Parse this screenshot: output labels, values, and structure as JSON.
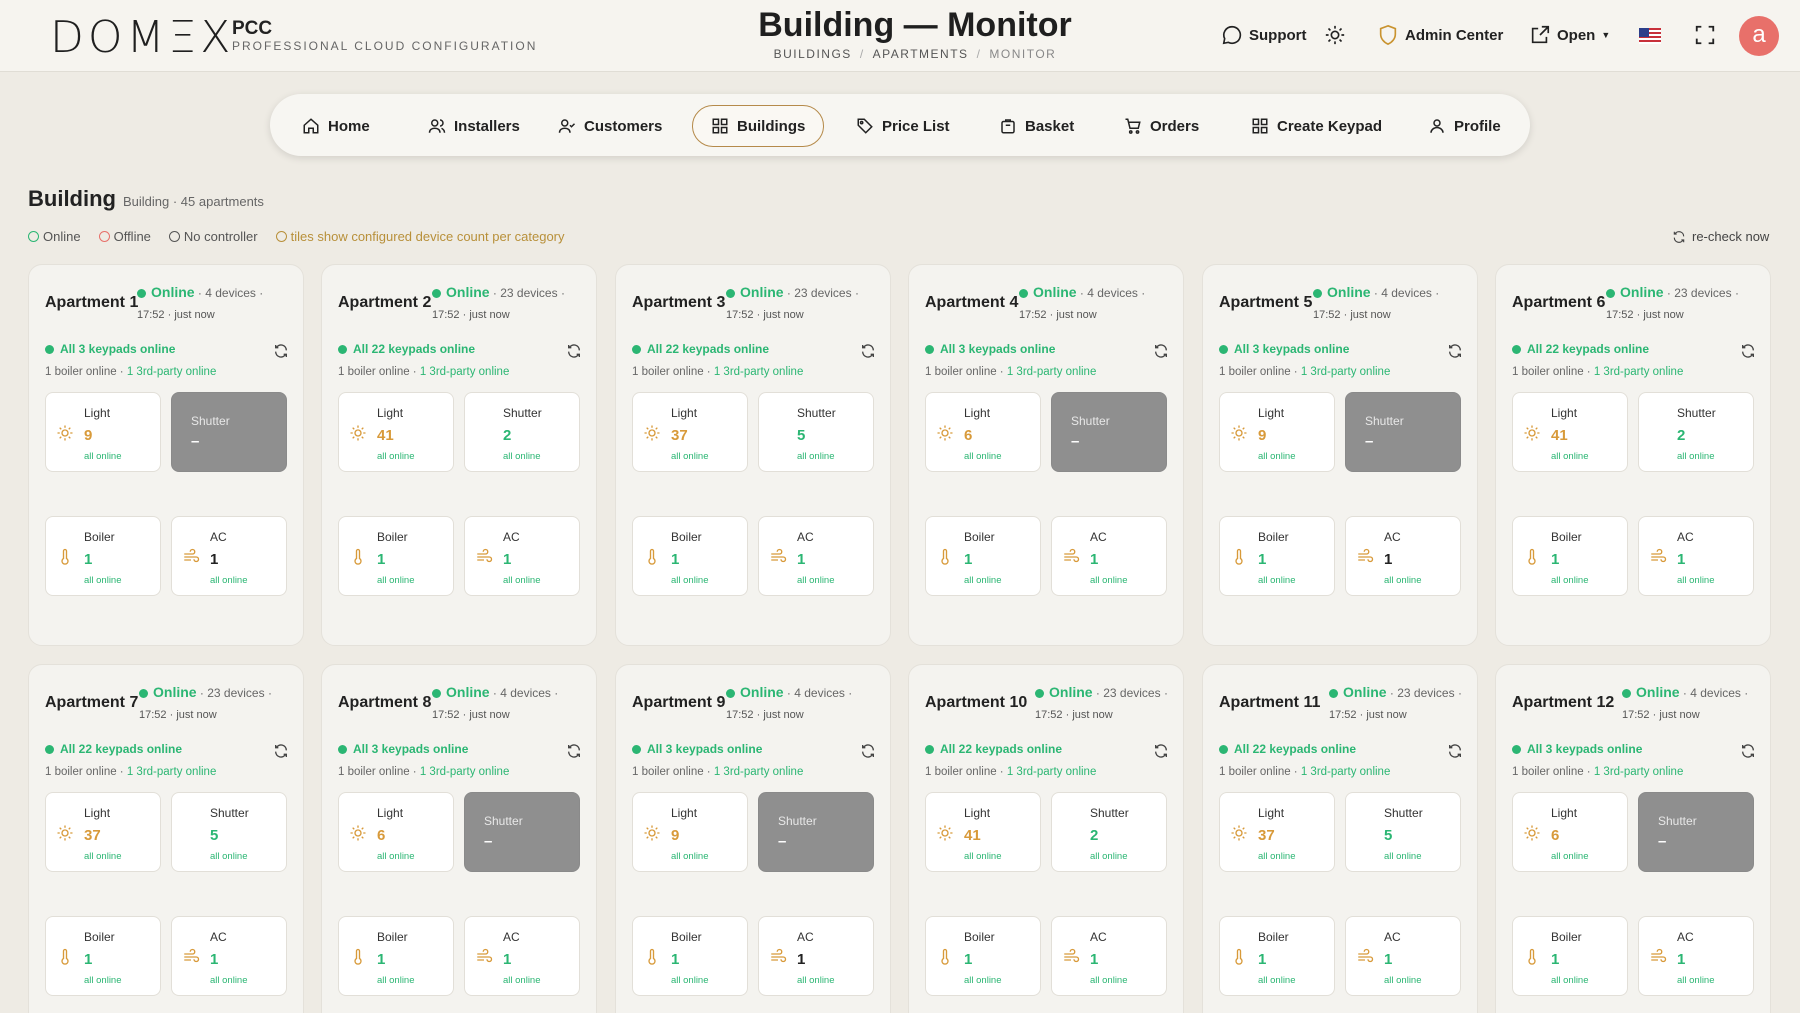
{
  "header": {
    "logo": "DOMΞX",
    "product": "PCC",
    "product_sub": "PROFESSIONAL CLOUD CONFIGURATION",
    "title": "Building — Monitor",
    "breadcrumb": [
      "BUILDINGS",
      "APARTMENTS",
      "MONITOR"
    ],
    "support": "Support",
    "admin_center": "Admin Center",
    "open": "Open",
    "avatar": "a"
  },
  "nav": [
    {
      "label": "Home",
      "icon": "home-icon"
    },
    {
      "label": "Installers",
      "icon": "users-icon"
    },
    {
      "label": "Customers",
      "icon": "user-check-icon"
    },
    {
      "label": "Buildings",
      "icon": "grid-icon",
      "active": true
    },
    {
      "label": "Price List",
      "icon": "tag-icon"
    },
    {
      "label": "Basket",
      "icon": "basket-icon"
    },
    {
      "label": "Orders",
      "icon": "cart-icon"
    },
    {
      "label": "Create Keypad",
      "icon": "keypad-icon"
    },
    {
      "label": "Profile",
      "icon": "person-icon"
    }
  ],
  "building": {
    "title": "Building",
    "subtitle": "Building · 45 apartments",
    "legend": {
      "online": "Online",
      "offline": "Offline",
      "no_controller": "No controller",
      "note": "tiles show configured device count per category"
    },
    "recheck": "re-check now"
  },
  "colors": {
    "online": "#2bb673",
    "light_value": "#d89a3a",
    "offline_tile": "#8f8f8f",
    "accent": "#b58a4a"
  },
  "apartments": [
    {
      "name": "Apartment 1",
      "status": "Online",
      "devices": "4 devices",
      "time": "17:52",
      "ago": "just now",
      "keypads": "All 3 keypads online",
      "boiler": "1 boiler online",
      "third": "1 3rd-party online",
      "light": "9",
      "shutter": "–",
      "shutter_off": true,
      "boiler_n": "1",
      "ac": "1"
    },
    {
      "name": "Apartment 2",
      "status": "Online",
      "devices": "23 devices",
      "time": "17:52",
      "ago": "just now",
      "keypads": "All 22 keypads online",
      "boiler": "1 boiler online",
      "third": "1 3rd-party online",
      "light": "41",
      "shutter": "2",
      "shutter_off": false,
      "boiler_n": "1",
      "ac": "1"
    },
    {
      "name": "Apartment 3",
      "status": "Online",
      "devices": "23 devices",
      "time": "17:52",
      "ago": "just now",
      "keypads": "All 22 keypads online",
      "boiler": "1 boiler online",
      "third": "1 3rd-party online",
      "light": "37",
      "shutter": "5",
      "shutter_off": false,
      "boiler_n": "1",
      "ac": "1"
    },
    {
      "name": "Apartment 4",
      "status": "Online",
      "devices": "4 devices",
      "time": "17:52",
      "ago": "just now",
      "keypads": "All 3 keypads online",
      "boiler": "1 boiler online",
      "third": "1 3rd-party online",
      "light": "6",
      "shutter": "–",
      "shutter_off": true,
      "boiler_n": "1",
      "ac": "1"
    },
    {
      "name": "Apartment 5",
      "status": "Online",
      "devices": "4 devices",
      "time": "17:52",
      "ago": "just now",
      "keypads": "All 3 keypads online",
      "boiler": "1 boiler online",
      "third": "1 3rd-party online",
      "light": "9",
      "shutter": "–",
      "shutter_off": true,
      "boiler_n": "1",
      "ac": "1"
    },
    {
      "name": "Apartment 6",
      "status": "Online",
      "devices": "23 devices",
      "time": "17:52",
      "ago": "just now",
      "keypads": "All 22 keypads online",
      "boiler": "1 boiler online",
      "third": "1 3rd-party online",
      "light": "41",
      "shutter": "2",
      "shutter_off": false,
      "boiler_n": "1",
      "ac": "1"
    },
    {
      "name": "Apartment 7",
      "status": "Online",
      "devices": "23 devices",
      "time": "17:52",
      "ago": "just now",
      "keypads": "All 22 keypads online",
      "boiler": "1 boiler online",
      "third": "1 3rd-party online",
      "light": "37",
      "shutter": "5",
      "shutter_off": false,
      "boiler_n": "1",
      "ac": "1"
    },
    {
      "name": "Apartment 8",
      "status": "Online",
      "devices": "4 devices",
      "time": "17:52",
      "ago": "just now",
      "keypads": "All 3 keypads online",
      "boiler": "1 boiler online",
      "third": "1 3rd-party online",
      "light": "6",
      "shutter": "–",
      "shutter_off": true,
      "boiler_n": "1",
      "ac": "1"
    },
    {
      "name": "Apartment 9",
      "status": "Online",
      "devices": "4 devices",
      "time": "17:52",
      "ago": "just now",
      "keypads": "All 3 keypads online",
      "boiler": "1 boiler online",
      "third": "1 3rd-party online",
      "light": "9",
      "shutter": "–",
      "shutter_off": true,
      "boiler_n": "1",
      "ac": "1"
    },
    {
      "name": "Apartment 10",
      "status": "Online",
      "devices": "23 devices",
      "time": "17:52",
      "ago": "just now",
      "keypads": "All 22 keypads online",
      "boiler": "1 boiler online",
      "third": "1 3rd-party online",
      "light": "41",
      "shutter": "2",
      "shutter_off": false,
      "boiler_n": "1",
      "ac": "1"
    },
    {
      "name": "Apartment 11",
      "status": "Online",
      "devices": "23 devices",
      "time": "17:52",
      "ago": "just now",
      "keypads": "All 22 keypads online",
      "boiler": "1 boiler online",
      "third": "1 3rd-party online",
      "light": "37",
      "shutter": "5",
      "shutter_off": false,
      "boiler_n": "1",
      "ac": "1"
    },
    {
      "name": "Apartment 12",
      "status": "Online",
      "devices": "4 devices",
      "time": "17:52",
      "ago": "just now",
      "keypads": "All 3 keypads online",
      "boiler": "1 boiler online",
      "third": "1 3rd-party online",
      "light": "6",
      "shutter": "–",
      "shutter_off": true,
      "boiler_n": "1",
      "ac": "1"
    }
  ],
  "tile_labels": {
    "light": "Light",
    "shutter": "Shutter",
    "boiler": "Boiler",
    "ac": "AC",
    "sub": "all online"
  }
}
